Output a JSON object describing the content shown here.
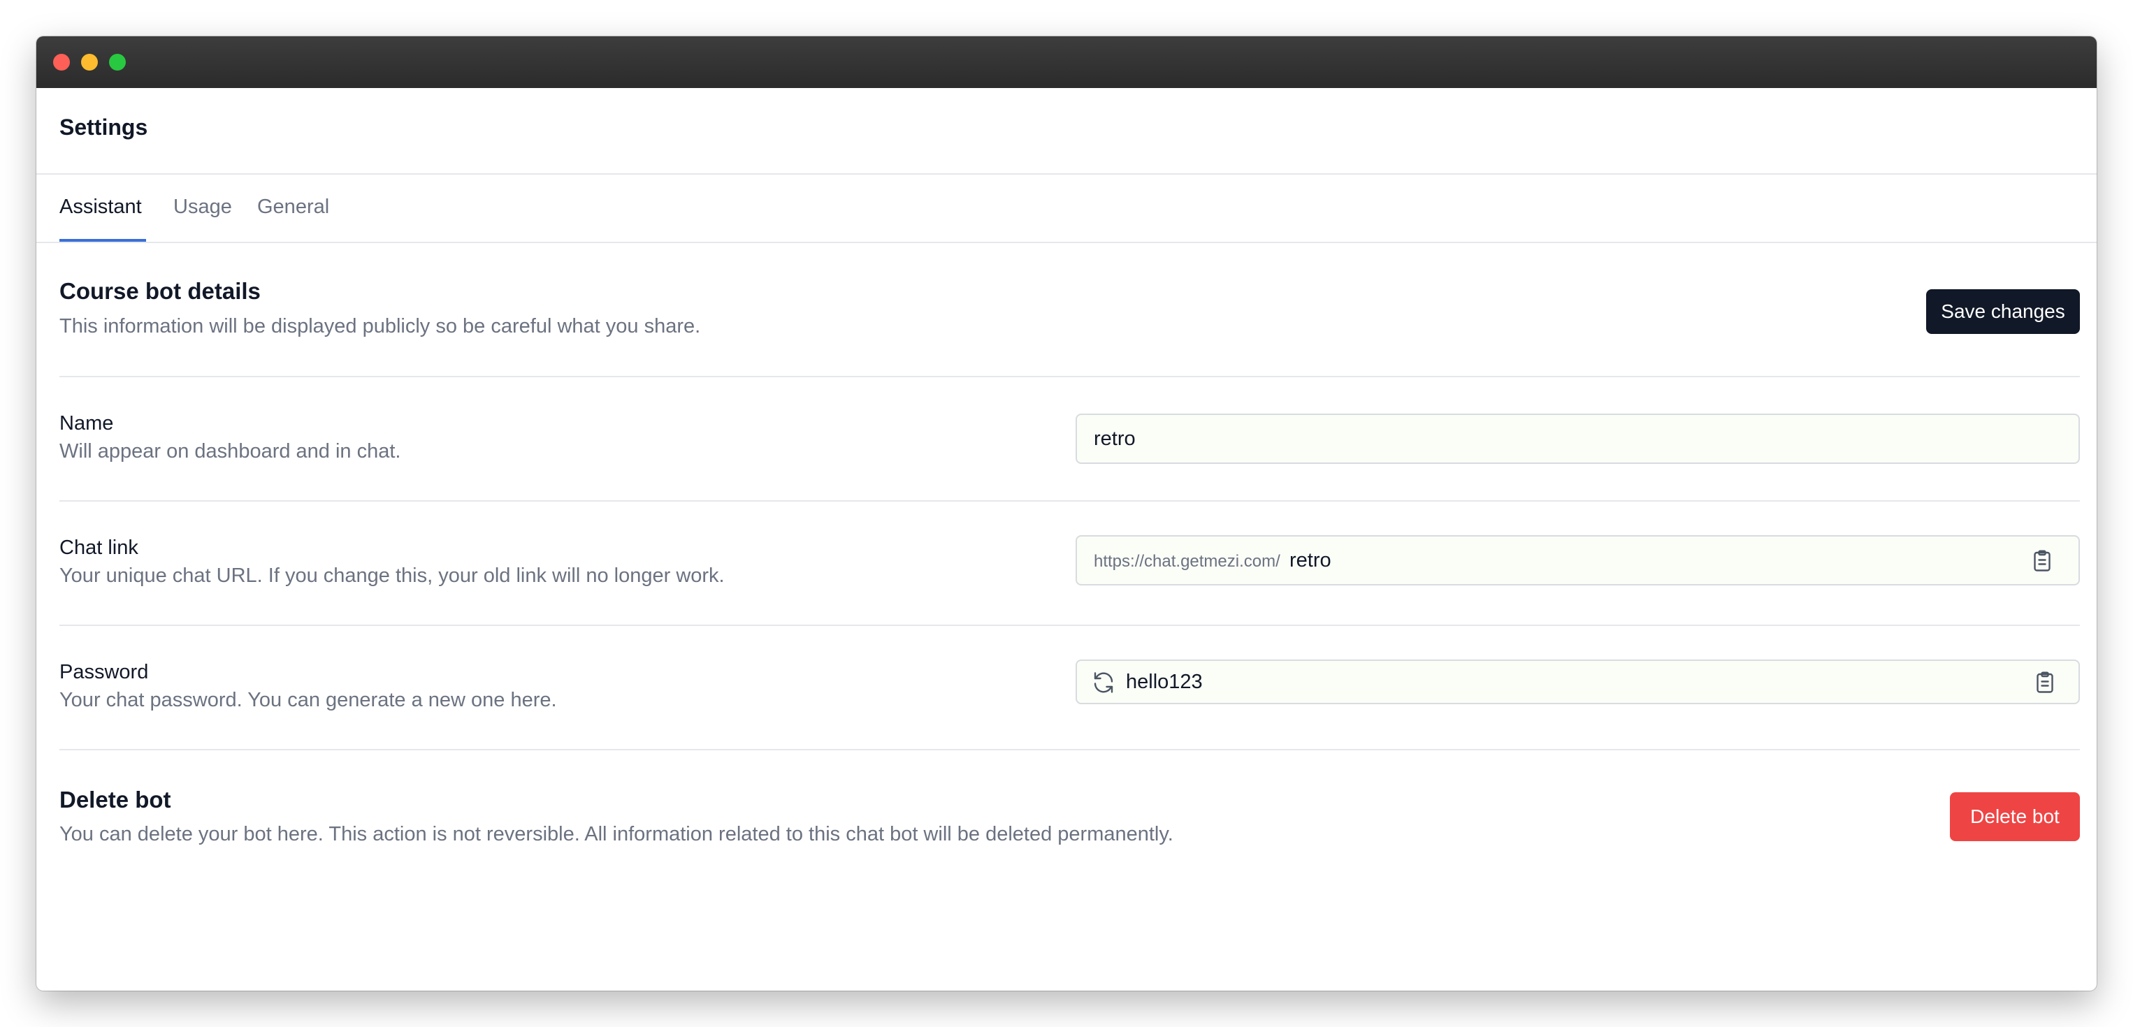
{
  "page": {
    "title": "Settings"
  },
  "tabs": [
    {
      "label": "Assistant",
      "active": true
    },
    {
      "label": "Usage",
      "active": false
    },
    {
      "label": "General",
      "active": false
    }
  ],
  "details": {
    "title": "Course bot details",
    "description": "This information will be displayed publicly so be careful what you share.",
    "save_label": "Save changes"
  },
  "fields": {
    "name": {
      "label": "Name",
      "help": "Will appear on dashboard and in chat.",
      "value": "retro"
    },
    "chat_link": {
      "label": "Chat link",
      "help": "Your unique chat URL. If you change this, your old link will no longer work.",
      "prefix": "https://chat.getmezi.com/",
      "value": "retro"
    },
    "password": {
      "label": "Password",
      "help": "Your chat password. You can generate a new one here.",
      "value": "hello123"
    }
  },
  "delete": {
    "title": "Delete bot",
    "description": "You can delete your bot here. This action is not reversible. All information related to this chat bot will be deleted permanently.",
    "button_label": "Delete bot"
  },
  "icons": {
    "window_close": "close-icon",
    "window_minimize": "minimize-icon",
    "window_maximize": "maximize-icon",
    "copy": "clipboard-icon",
    "regenerate": "refresh-icon"
  },
  "colors": {
    "accent": "#3b6fd8",
    "primary_button": "#111827",
    "danger": "#ef4444"
  }
}
